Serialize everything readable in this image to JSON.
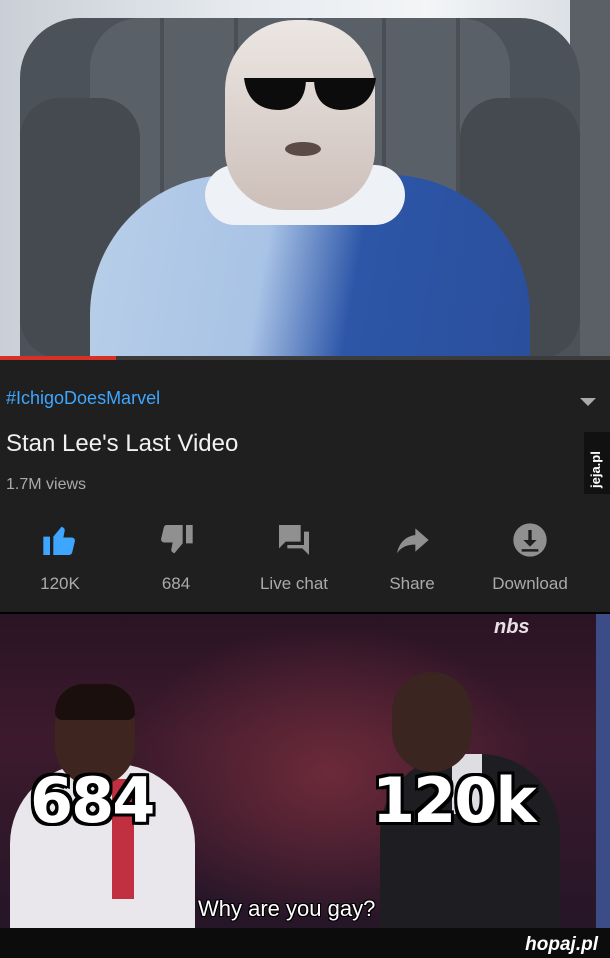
{
  "video": {
    "progress_fraction": 0.19,
    "progress_color": "#d93025"
  },
  "info": {
    "hashtag": "#IchigoDoesMarvel",
    "title": "Stan Lee's Last Video",
    "views": "1.7M views",
    "side_logo": "jeja.pl",
    "accent_color": "#3ea6ff",
    "actions": [
      {
        "icon": "thumbs-up-icon",
        "label": "120K",
        "active": true
      },
      {
        "icon": "thumbs-down-icon",
        "label": "684"
      },
      {
        "icon": "live-chat-icon",
        "label": "Live chat"
      },
      {
        "icon": "share-arrow-icon",
        "label": "Share"
      },
      {
        "icon": "download-icon",
        "label": "Download"
      }
    ]
  },
  "news": {
    "channel_logo": "nbs",
    "left_label": "684",
    "right_label": "120k",
    "subtitle": "Why are you gay?"
  },
  "footer": {
    "brand": "hopaj.pl"
  }
}
